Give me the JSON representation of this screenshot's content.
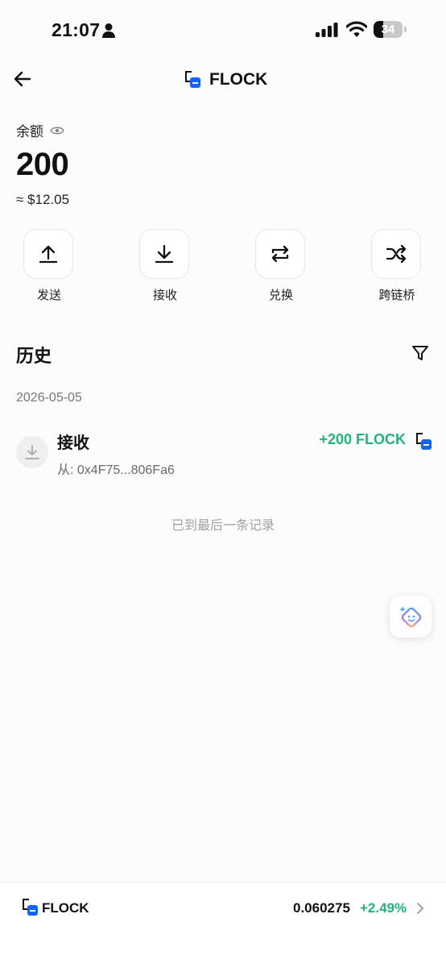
{
  "status_bar": {
    "time": "21:07",
    "battery": "34",
    "battery_level": 0.34
  },
  "header": {
    "title": "FLOCK"
  },
  "balance": {
    "label": "余额",
    "amount": "200",
    "usd": "≈ $12.05"
  },
  "actions": [
    {
      "label": "发送",
      "icon": "upload-icon"
    },
    {
      "label": "接收",
      "icon": "download-icon"
    },
    {
      "label": "兑换",
      "icon": "swap-icon"
    },
    {
      "label": "跨链桥",
      "icon": "shuffle-icon"
    }
  ],
  "history": {
    "title": "历史",
    "groups": [
      {
        "date": "2026-05-05",
        "transactions": [
          {
            "type": "接收",
            "from": "从: 0x4F75...806Fa6",
            "amount": "+200 FLOCK"
          }
        ]
      }
    ],
    "end_note": "已到最后一条记录"
  },
  "ticker": {
    "name": "FLOCK",
    "price": "0.060275",
    "change": "+2.49%"
  },
  "colors": {
    "positive": "#20b57c",
    "token_blue": "#1463ff"
  }
}
